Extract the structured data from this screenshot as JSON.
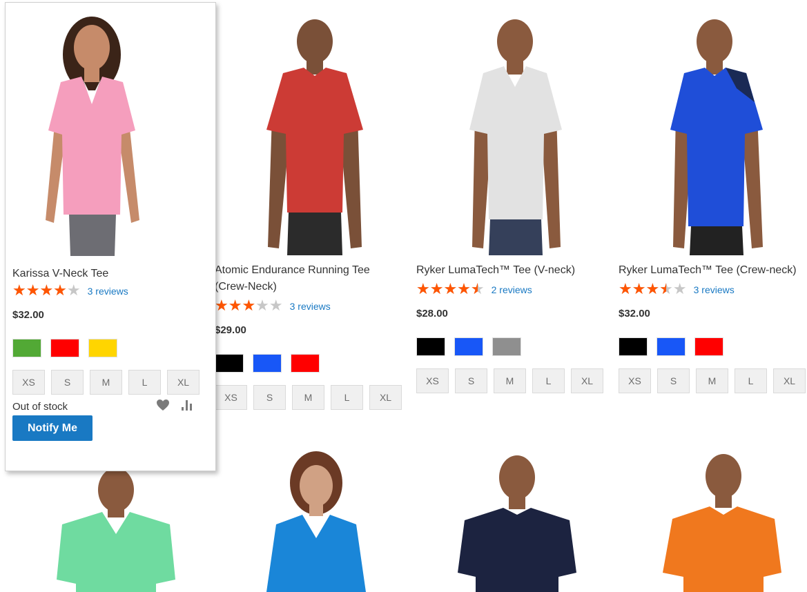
{
  "products": [
    {
      "name_line1": "Karissa V-Neck Tee",
      "name_line2": "",
      "rating_fraction": 0.8,
      "reviews": "3 reviews",
      "price": "$32.00",
      "swatches": [
        "#52a935",
        "#ff0000",
        "#ffd500"
      ],
      "sizes": [
        "XS",
        "S",
        "M",
        "L",
        "XL"
      ],
      "stock": "Out of stock",
      "notify_label": "Notify Me",
      "shirt_color": "#f59ebd",
      "skin_color": "#c68b6a",
      "bottom_color": "#6d6d73"
    },
    {
      "name_line1": "Atomic Endurance Running Tee",
      "name_line2": "(Crew-Neck)",
      "rating_fraction": 0.6,
      "reviews": "3 reviews",
      "price": "$29.00",
      "swatches": [
        "#000000",
        "#1857f7",
        "#ff0000"
      ],
      "sizes": [
        "XS",
        "S",
        "M",
        "L",
        "XL"
      ],
      "shirt_color": "#cc3b35",
      "skin_color": "#7a5038",
      "bottom_color": "#2b2b2b"
    },
    {
      "name_line1": "Ryker LumaTech™ Tee (V-neck)",
      "name_line2": "",
      "rating_fraction": 0.9,
      "reviews": "2 reviews",
      "price": "$28.00",
      "swatches": [
        "#000000",
        "#1857f7",
        "#8f8f8f"
      ],
      "sizes": [
        "XS",
        "S",
        "M",
        "L",
        "XL"
      ],
      "shirt_color": "#e2e2e2",
      "skin_color": "#8a5a3e",
      "bottom_color": "#35405a"
    },
    {
      "name_line1": "Ryker LumaTech™ Tee (Crew-neck)",
      "name_line2": "",
      "rating_fraction": 0.7,
      "reviews": "3 reviews",
      "price": "$32.00",
      "swatches": [
        "#000000",
        "#1857f7",
        "#ff0000"
      ],
      "sizes": [
        "XS",
        "S",
        "M",
        "L",
        "XL"
      ],
      "shirt_color": "#1f4ed8",
      "skin_color": "#8a5a3e",
      "bottom_color": "#222222"
    }
  ],
  "row2_products": [
    {
      "shirt_color": "#6fdba0",
      "skin_color": "#8a5a3e"
    },
    {
      "shirt_color": "#1a86d8",
      "skin_color": "#d0a184"
    },
    {
      "shirt_color": "#1c2340",
      "skin_color": "#8a5a3e"
    },
    {
      "shirt_color": "#f0781e",
      "skin_color": "#8a5a3e"
    }
  ],
  "icons": {
    "wishlist": "heart-icon",
    "compare": "compare-chart-icon",
    "star": "star-icon"
  },
  "colors": {
    "star_filled": "#ff5501",
    "star_empty": "#c7c7c7",
    "link": "#1979c3",
    "button": "#1979c3"
  }
}
